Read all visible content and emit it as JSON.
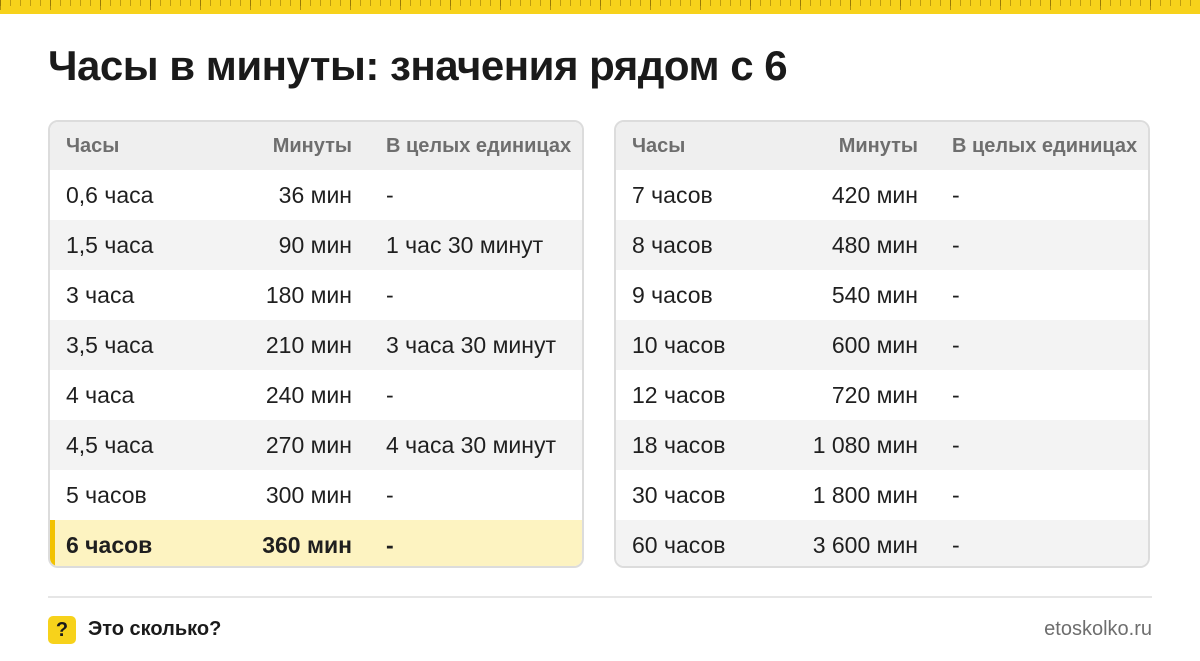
{
  "title": "Часы в минуты: значения рядом с 6",
  "headers": {
    "hours": "Часы",
    "minutes": "Минуты",
    "whole": "В целых единицах"
  },
  "left_table": [
    {
      "hours": "0,6 часа",
      "minutes": "36 мин",
      "whole": "-"
    },
    {
      "hours": "1,5 часа",
      "minutes": "90 мин",
      "whole": "1 час 30 минут"
    },
    {
      "hours": "3 часа",
      "minutes": "180 мин",
      "whole": "-"
    },
    {
      "hours": "3,5 часа",
      "minutes": "210 мин",
      "whole": "3 часа 30 минут"
    },
    {
      "hours": "4 часа",
      "minutes": "240 мин",
      "whole": "-"
    },
    {
      "hours": "4,5 часа",
      "minutes": "270 мин",
      "whole": "4 часа 30 минут"
    },
    {
      "hours": "5 часов",
      "minutes": "300 мин",
      "whole": "-"
    },
    {
      "hours": "6 часов",
      "minutes": "360 мин",
      "whole": "-"
    }
  ],
  "right_table": [
    {
      "hours": "7 часов",
      "minutes": "420 мин",
      "whole": "-"
    },
    {
      "hours": "8 часов",
      "minutes": "480 мин",
      "whole": "-"
    },
    {
      "hours": "9 часов",
      "minutes": "540 мин",
      "whole": "-"
    },
    {
      "hours": "10 часов",
      "minutes": "600 мин",
      "whole": "-"
    },
    {
      "hours": "12 часов",
      "minutes": "720 мин",
      "whole": "-"
    },
    {
      "hours": "18 часов",
      "minutes": "1 080 мин",
      "whole": "-"
    },
    {
      "hours": "30 часов",
      "minutes": "1 800 мин",
      "whole": "-"
    },
    {
      "hours": "60 часов",
      "minutes": "3 600 мин",
      "whole": "-"
    }
  ],
  "footer": {
    "badge": "?",
    "brand": "Это сколько?",
    "site": "etoskolko.ru"
  },
  "colors": {
    "accent": "#f7d21b",
    "highlight_row": "#fdf3c1",
    "header_bg": "#efefef",
    "alt_row": "#f3f3f3"
  }
}
